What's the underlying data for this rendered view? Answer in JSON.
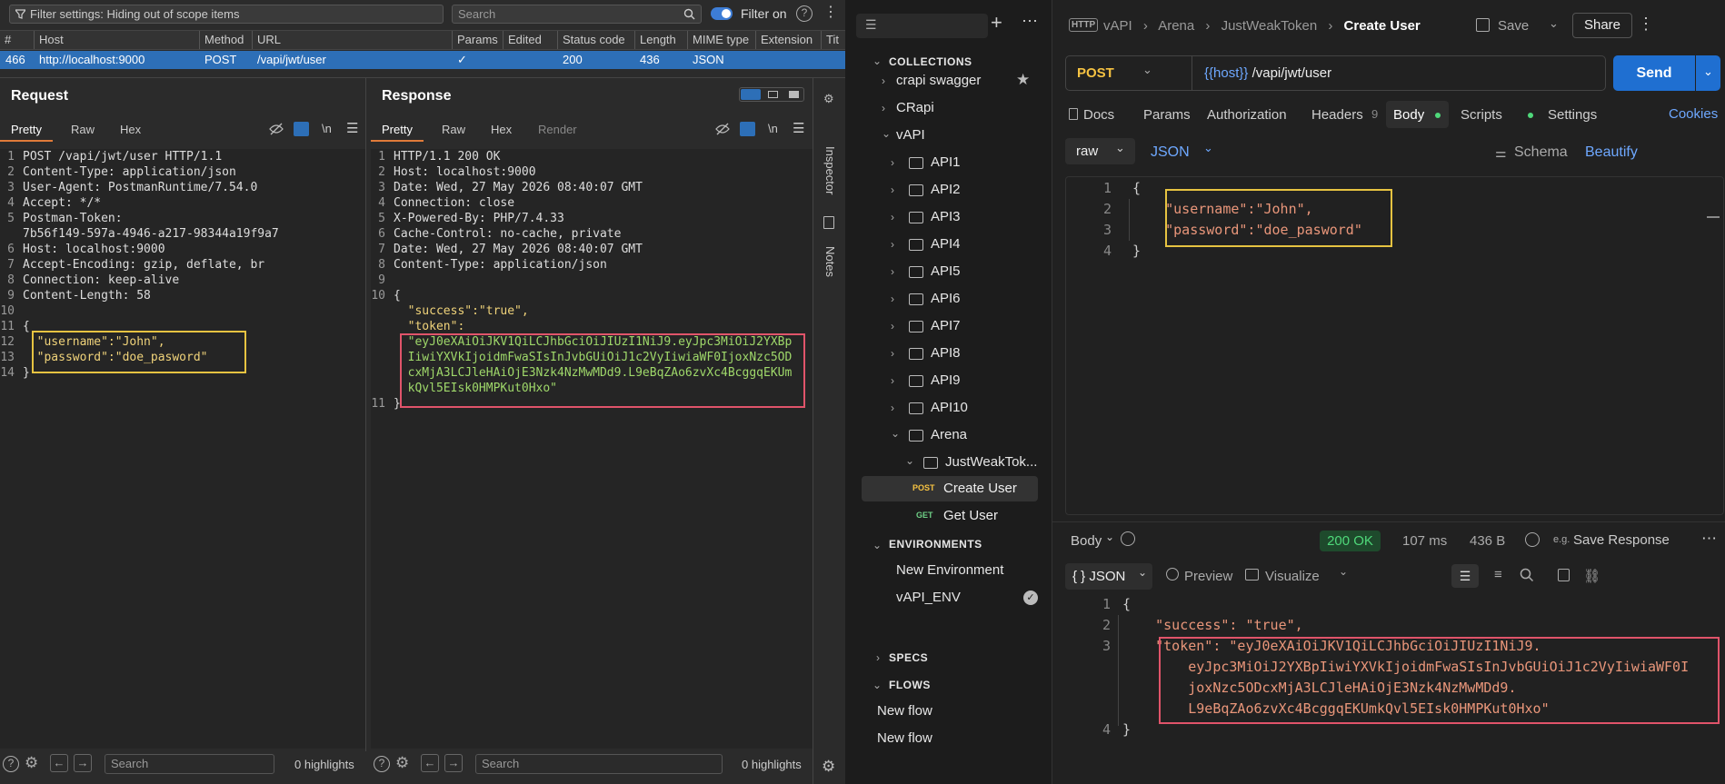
{
  "burp": {
    "filter_text": "Filter settings: Hiding out of scope items",
    "search_placeholder": "Search",
    "filter_on_label": "Filter on",
    "columns": [
      "#",
      "Host",
      "Method",
      "URL",
      "Params",
      "Edited",
      "Status code",
      "Length",
      "MIME type",
      "Extension",
      "Tit"
    ],
    "row": {
      "num": "466",
      "host": "http://localhost:9000",
      "method": "POST",
      "url": "/vapi/jwt/user",
      "params": "✓",
      "edited": "",
      "status": "200",
      "length": "436",
      "mime": "JSON",
      "extension": ""
    },
    "request": {
      "title": "Request",
      "tabs": [
        "Pretty",
        "Raw",
        "Hex"
      ],
      "wrap_label": "\\n",
      "line_numbers": [
        "1",
        "2",
        "3",
        "4",
        "5",
        "",
        "6",
        "7",
        "8",
        "9",
        "10",
        "11",
        "12",
        "13",
        "14"
      ],
      "lines": [
        "POST /vapi/jwt/user HTTP/1.1",
        "Content-Type: application/json",
        "User-Agent: PostmanRuntime/7.54.0",
        "Accept: */*",
        "Postman-Token:",
        "7b56f149-597a-4946-a217-98344a19f9a7",
        "Host: localhost:9000",
        "Accept-Encoding: gzip, deflate, br",
        "Connection: keep-alive",
        "Content-Length: 58",
        "",
        "{",
        "  \"username\":\"John\",",
        "  \"password\":\"doe_pasword\"",
        "}"
      ],
      "search_placeholder": "Search",
      "highlights": "0 highlights"
    },
    "response": {
      "title": "Response",
      "tabs": [
        "Pretty",
        "Raw",
        "Hex",
        "Render"
      ],
      "wrap_label": "\\n",
      "line_numbers": [
        "1",
        "2",
        "3",
        "4",
        "5",
        "6",
        "7",
        "8",
        "9",
        "10",
        "",
        "",
        "",
        "",
        "",
        "",
        "11"
      ],
      "lines": [
        "HTTP/1.1 200 OK",
        "Host: localhost:9000",
        "Date: Wed, 27 May 2026 08:40:07 GMT",
        "Connection: close",
        "X-Powered-By: PHP/7.4.33",
        "Cache-Control: no-cache, private",
        "Date: Wed, 27 May 2026 08:40:07 GMT",
        "Content-Type: application/json",
        "",
        "{",
        "  \"success\":\"true\",",
        "  \"token\":",
        "  \"eyJ0eXAiOiJKV1QiLCJhbGciOiJIUzI1NiJ9.eyJpc3MiOiJ2YXBp",
        "  IiwiYXVkIjoidmFwaSIsInJvbGUiOiJ1c2VyIiwiaWF0IjoxNzc5OD",
        "  cxMjA3LCJleHAiOjE3Nzk4NzMwMDd9.L9eBqZAo6zvXc4BcggqEKUm",
        "  kQvl5EIsk0HMPKut0Hxo\"",
        "}"
      ],
      "search_placeholder": "Search",
      "highlights": "0 highlights"
    },
    "side_tabs": [
      "Inspector",
      "Notes"
    ]
  },
  "postman": {
    "sidebar": {
      "collections_label": "COLLECTIONS",
      "collections": [
        {
          "name": "crapi swagger",
          "starred": true
        },
        {
          "name": "CRapi"
        },
        {
          "name": "vAPI",
          "expanded": true
        }
      ],
      "folders": [
        "API1",
        "API2",
        "API3",
        "API4",
        "API5",
        "API6",
        "API7",
        "API8",
        "API9",
        "API10",
        "Arena",
        "JustWeakTok..."
      ],
      "requests": [
        {
          "method": "POST",
          "name": "Create User",
          "selected": true
        },
        {
          "method": "GET",
          "name": "Get User"
        }
      ],
      "environments_label": "ENVIRONMENTS",
      "environments": [
        "New Environment",
        "vAPI_ENV"
      ],
      "specs_label": "SPECS",
      "flows_label": "FLOWS",
      "flows": [
        "New flow",
        "New flow"
      ]
    },
    "breadcrumb": [
      "vAPI",
      "Arena",
      "JustWeakToken"
    ],
    "request_name": "Create User",
    "save_label": "Save",
    "share_label": "Share",
    "method": "POST",
    "url_var": "{{host}}",
    "url_path": " /vapi/jwt/user",
    "send_label": "Send",
    "tabs": {
      "docs": "Docs",
      "params": "Params",
      "auth": "Authorization",
      "headers": "Headers",
      "headers_count": "9",
      "body": "Body",
      "scripts": "Scripts",
      "settings": "Settings",
      "cookies": "Cookies"
    },
    "body_mode": "raw",
    "body_lang": "JSON",
    "schema_label": "Schema",
    "beautify_label": "Beautify",
    "request_body": {
      "line_numbers": [
        "1",
        "2",
        "3",
        "4"
      ],
      "lines": [
        "{",
        "    \"username\":\"John\",",
        "    \"password\":\"doe_pasword\"",
        "}"
      ]
    },
    "response": {
      "body_label": "Body",
      "status": "200 OK",
      "time": "107 ms",
      "size": "436 B",
      "save_response": "Save Response",
      "format": "{ } JSON",
      "preview": "Preview",
      "visualize": "Visualize",
      "line_numbers": [
        "1",
        "2",
        "3",
        "",
        "",
        "",
        "4"
      ],
      "lines": [
        "{",
        "    \"success\": \"true\",",
        "    \"token\": \"eyJ0eXAiOiJKV1QiLCJhbGciOiJIUzI1NiJ9.",
        "        eyJpc3MiOiJ2YXBpIiwiYXVkIjoidmFwaSIsInJvbGUiOiJ1c2VyIiwiaWF0I",
        "        joxNzc5ODcxMjA3LCJleHAiOjE3Nzk4NzMwMDd9.",
        "        L9eBqZAo6zvXc4BcggqEKUmkQvl5EIsk0HMPKut0Hxo\"",
        "}"
      ]
    },
    "colors": {
      "accent": "#2d6fb7",
      "send": "#1f6fd1",
      "ok_bg": "#1e4a2c",
      "ok_text": "#4fd87a",
      "box_yellow": "#e6c341",
      "box_red": "#e0546a"
    }
  }
}
